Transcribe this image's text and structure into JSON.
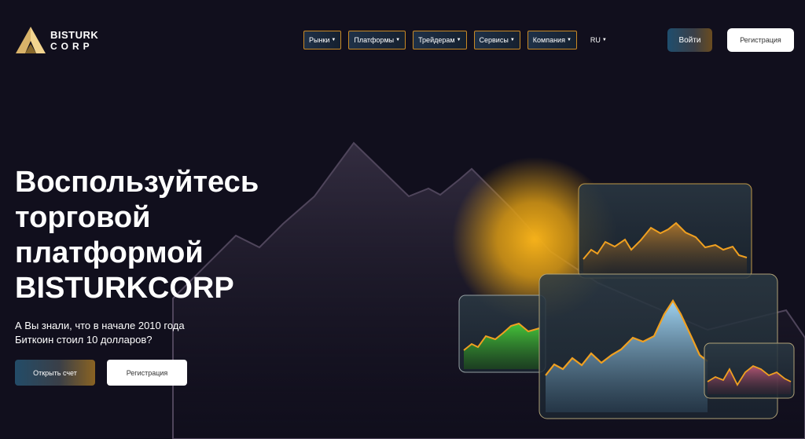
{
  "brand": {
    "line1": "BISTURK",
    "line2": "CORP"
  },
  "nav": {
    "items": [
      {
        "label": "Рынки"
      },
      {
        "label": "Платформы"
      },
      {
        "label": "Трейдерам"
      },
      {
        "label": "Сервисы"
      },
      {
        "label": "Компания"
      }
    ],
    "lang": "RU"
  },
  "header": {
    "login_label": "Войти",
    "register_label": "Регистрация"
  },
  "hero": {
    "title_lines": [
      "Воспользуйтесь",
      "торговой",
      "платформой",
      "BISTURKCORP"
    ],
    "subtitle_lines": [
      "А Вы знали, что в начале 2010 года",
      "Биткоин стоил 10 долларов?"
    ],
    "open_account_label": "Открыть счет",
    "register_label": "Регистрация"
  },
  "colors": {
    "background": "#110f1d",
    "accent_gold": "#f0a020",
    "nav_border": "#c98a25"
  },
  "icons": {
    "caret": "caret-down-icon",
    "logo": "bisturk-logo-icon"
  }
}
